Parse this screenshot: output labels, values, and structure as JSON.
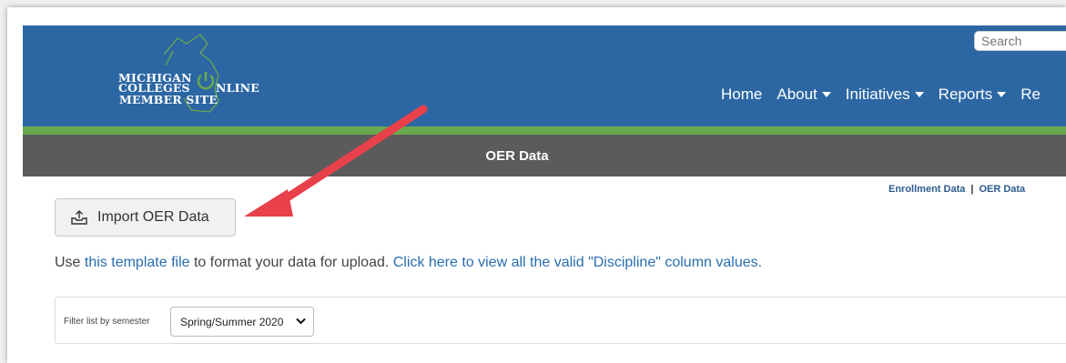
{
  "header": {
    "logo_lines": [
      "MICHIGAN",
      "COLLEGES",
      "NLINE",
      "MEMBER SITE"
    ],
    "search_placeholder": "Search",
    "nav": [
      {
        "label": "Home",
        "dropdown": false
      },
      {
        "label": "About",
        "dropdown": true
      },
      {
        "label": "Initiatives",
        "dropdown": true
      },
      {
        "label": "Reports",
        "dropdown": true
      },
      {
        "label": "Re",
        "dropdown": false
      }
    ],
    "colors": {
      "header": "#2c67a3",
      "green": "#6aa84f",
      "titlebar": "#5b5b5b"
    }
  },
  "titlebar": {
    "title": "OER Data"
  },
  "sublinks": {
    "enrollment": "Enrollment Data",
    "separator": "|",
    "oer": "OER Data"
  },
  "import": {
    "label": "Import OER Data",
    "icon": "upload-tray-icon"
  },
  "help": {
    "prefix": "Use ",
    "link1": "this template file",
    "middle": " to format your data for upload. ",
    "link2": "Click here to view all the valid \"Discipline\" column values."
  },
  "filter": {
    "label": "Filter list by semester",
    "selected": "Spring/Summer 2020"
  },
  "annotation": {
    "arrow_color": "#e8414b"
  }
}
